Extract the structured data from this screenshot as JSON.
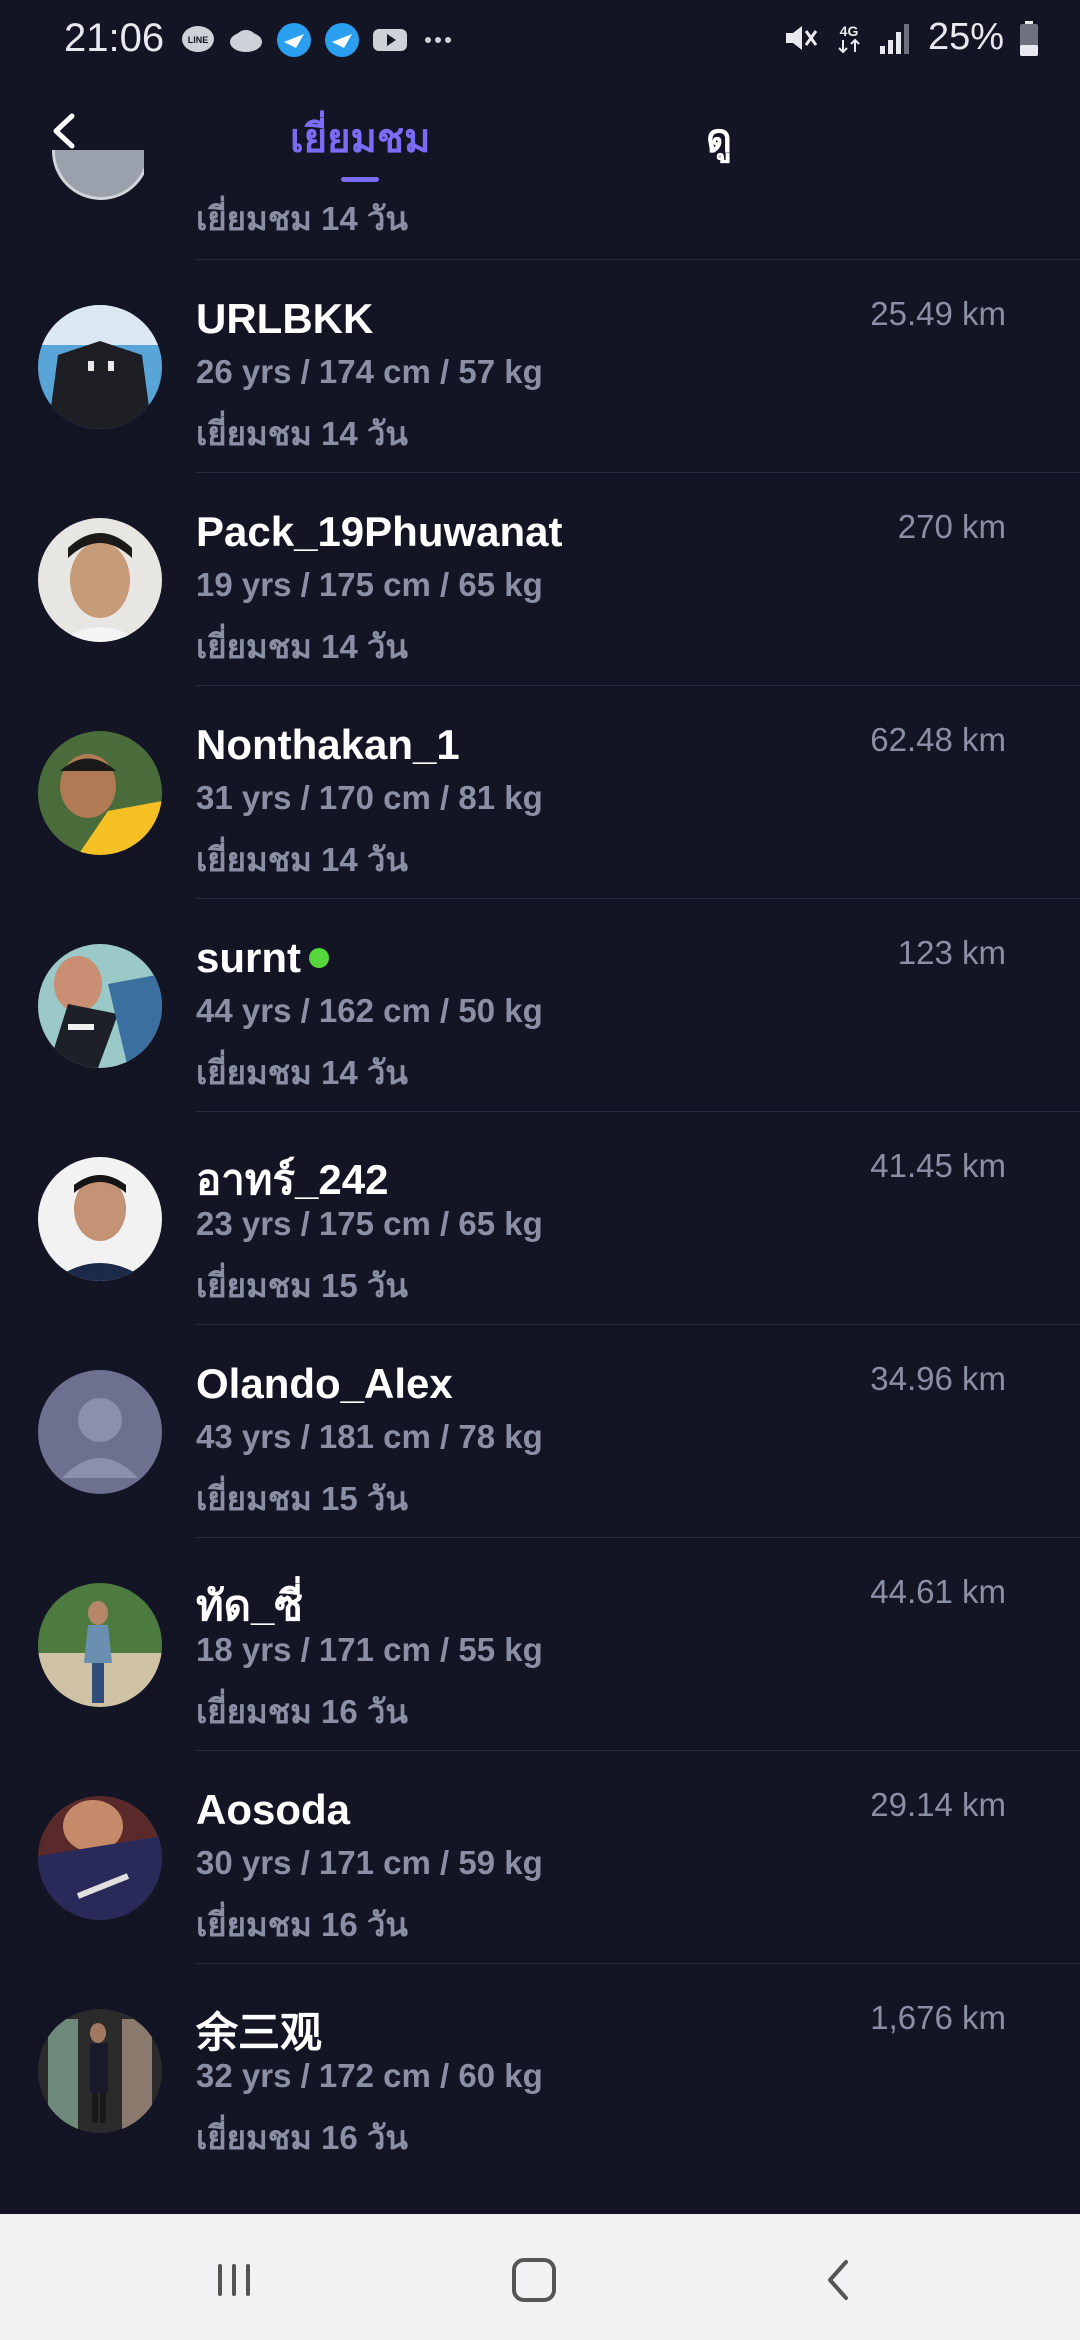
{
  "status_bar": {
    "time": "21:06",
    "notification_icons": [
      "line-icon",
      "cloud-icon",
      "bird-icon",
      "bird-icon",
      "youtube-icon",
      "more-dots-icon"
    ],
    "battery": "25%",
    "network": "4G"
  },
  "top_bar": {
    "tab_visit": "เยี่ยมชม",
    "tab_view": "ดู"
  },
  "partial_row": {
    "days": "เยี่ยมชม 14 วัน"
  },
  "rows": [
    {
      "name": "URLBKK",
      "stats": "26 yrs / 174 cm / 57 kg",
      "days": "เยี่ยมชม 14 วัน",
      "distance": "25.49 km",
      "online": false
    },
    {
      "name": "Pack_19Phuwanat",
      "stats": "19 yrs / 175 cm / 65 kg",
      "days": "เยี่ยมชม 14 วัน",
      "distance": "270 km",
      "online": false
    },
    {
      "name": "Nonthakan_1",
      "stats": "31 yrs / 170 cm / 81 kg",
      "days": "เยี่ยมชม 14 วัน",
      "distance": "62.48 km",
      "online": false
    },
    {
      "name": "surnt",
      "stats": "44 yrs / 162 cm / 50 kg",
      "days": "เยี่ยมชม 14 วัน",
      "distance": "123 km",
      "online": true
    },
    {
      "name": "อาทร์_242",
      "stats": "23 yrs / 175 cm / 65 kg",
      "days": "เยี่ยมชม 15 วัน",
      "distance": "41.45 km",
      "online": false
    },
    {
      "name": "Olando_Alex",
      "stats": "43 yrs / 181 cm / 78 kg",
      "days": "เยี่ยมชม 15 วัน",
      "distance": "34.96 km",
      "online": false
    },
    {
      "name": "ทัด_ซี่",
      "stats": "18 yrs / 171 cm / 55 kg",
      "days": "เยี่ยมชม 16 วัน",
      "distance": "44.61 km",
      "online": false
    },
    {
      "name": "Aosoda",
      "stats": "30 yrs / 171 cm / 59 kg",
      "days": "เยี่ยมชม 16 วัน",
      "distance": "29.14 km",
      "online": false
    },
    {
      "name": "余三观",
      "stats": "32 yrs / 172 cm / 60 kg",
      "days": "เยี่ยมชม 16 วัน",
      "distance": "1,676 km",
      "online": false
    }
  ],
  "colors": {
    "background": "#131525",
    "accent": "#7b6cf6",
    "secondary_text": "#8b8fa3",
    "online": "#55d63b",
    "nav_bar": "#f2f2f4"
  }
}
